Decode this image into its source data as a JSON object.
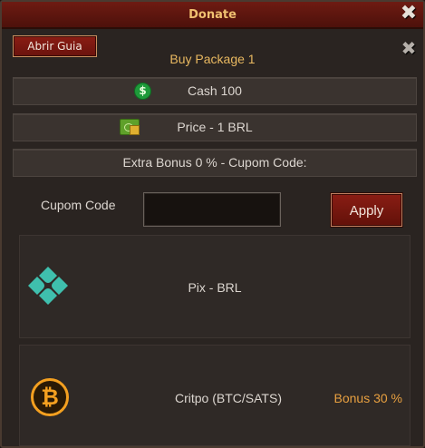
{
  "window": {
    "title": "Donate"
  },
  "guide_button": {
    "label": "Abrir Guia"
  },
  "package": {
    "title": "Buy Package 1",
    "cash_label": "Cash 100",
    "price_label": "Price - 1 BRL",
    "bonus_label": "Extra Bonus 0 % - Cupom Code:"
  },
  "coupon": {
    "label": "Cupom Code",
    "value": "",
    "apply_label": "Apply"
  },
  "methods": [
    {
      "label": "Pix - BRL",
      "bonus": ""
    },
    {
      "label": "Critpo (BTC/SATS)",
      "bonus": "Bonus 30 %"
    }
  ],
  "icons": {
    "close": "close-icon",
    "cash": "cash-coin-icon",
    "price": "money-bill-icon",
    "pix": "pix-icon",
    "btc": "bitcoin-icon"
  },
  "colors": {
    "title_gold": "#f0c070",
    "accent_red": "#8a1d14",
    "bonus_orange": "#e8a040",
    "pix_teal": "#3fbfad",
    "btc_orange": "#f4a020"
  }
}
